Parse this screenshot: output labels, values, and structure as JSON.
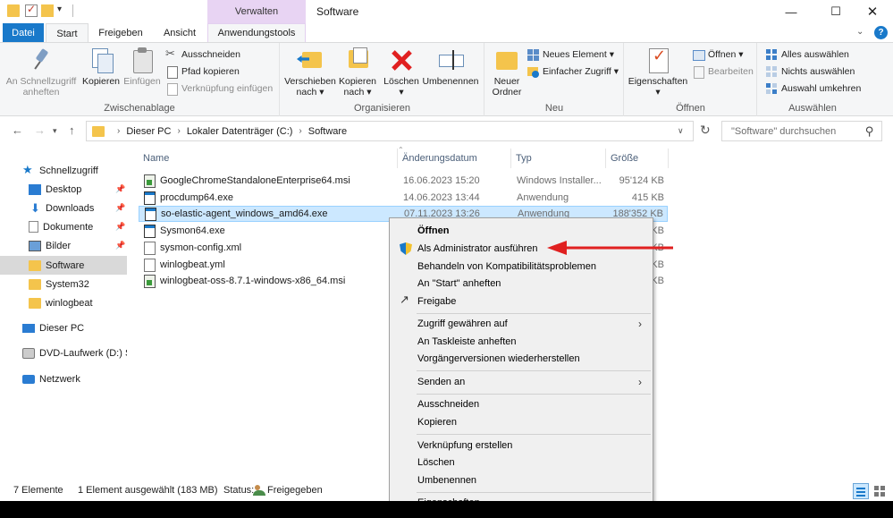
{
  "titlebar": {
    "context_tab_header": "Verwalten",
    "window_title": "Software",
    "minimize": "—",
    "maximize": "☐",
    "close": "✕"
  },
  "tabs": [
    {
      "label": "Datei"
    },
    {
      "label": "Start"
    },
    {
      "label": "Freigeben"
    },
    {
      "label": "Ansicht"
    },
    {
      "label": "Anwendungstools"
    }
  ],
  "ribbon": {
    "clipboard": {
      "label": "Zwischenablage",
      "pin": "An Schnellzugriff anheften",
      "pin_l1": "An Schnellzugriff",
      "pin_l2": "anheften",
      "copy": "Kopieren",
      "paste": "Einfügen",
      "cut": "Ausschneiden",
      "copy_path": "Pfad kopieren",
      "paste_shortcut": "Verknüpfung einfügen"
    },
    "organize": {
      "label": "Organisieren",
      "move_l1": "Verschieben",
      "move_l2": "nach ▾",
      "copyto_l1": "Kopieren",
      "copyto_l2": "nach ▾",
      "delete_l1": "Löschen",
      "delete_l2": "▾",
      "rename": "Umbenennen"
    },
    "new": {
      "label": "Neu",
      "newfolder_l1": "Neuer",
      "newfolder_l2": "Ordner",
      "new_item": "Neues Element ▾",
      "easy_access": "Einfacher Zugriff ▾"
    },
    "open": {
      "label": "Öffnen",
      "properties_l1": "Eigenschaften",
      "properties_l2": "▾",
      "open": "Öffnen ▾",
      "edit": "Bearbeiten"
    },
    "select": {
      "label": "Auswählen",
      "select_all": "Alles auswählen",
      "select_none": "Nichts auswählen",
      "invert": "Auswahl umkehren"
    }
  },
  "address": {
    "crumbs": [
      "Dieser PC",
      "Lokaler Datenträger (C:)",
      "Software"
    ],
    "search_placeholder": "\"Software\" durchsuchen"
  },
  "navpane": [
    {
      "label": "Schnellzugriff",
      "icon": "star-icon"
    },
    {
      "label": "Desktop",
      "icon": "desktop-icon",
      "pinned": true
    },
    {
      "label": "Downloads",
      "icon": "download-icon",
      "pinned": true
    },
    {
      "label": "Dokumente",
      "icon": "documents-icon",
      "pinned": true
    },
    {
      "label": "Bilder",
      "icon": "pictures-icon",
      "pinned": true
    },
    {
      "label": "Software",
      "icon": "folder-icon",
      "selected": true
    },
    {
      "label": "System32",
      "icon": "folder-icon"
    },
    {
      "label": "winlogbeat",
      "icon": "folder-icon"
    },
    {
      "label": "Dieser PC",
      "icon": "pc-icon"
    },
    {
      "label": "DVD-Laufwerk (D:) SS",
      "icon": "dvd-icon"
    },
    {
      "label": "Netzwerk",
      "icon": "network-icon"
    }
  ],
  "columns": {
    "name": "Name",
    "date": "Änderungsdatum",
    "type": "Typ",
    "size": "Größe"
  },
  "files": [
    {
      "name": "GoogleChromeStandaloneEnterprise64.msi",
      "date": "16.06.2023 15:20",
      "type": "Windows Installer...",
      "size": "95'124 KB",
      "icon": "msi-icon"
    },
    {
      "name": "procdump64.exe",
      "date": "14.06.2023 13:44",
      "type": "Anwendung",
      "size": "415 KB",
      "icon": "exe-icon"
    },
    {
      "name": "so-elastic-agent_windows_amd64.exe",
      "date": "07.11.2023 13:26",
      "type": "Anwendung",
      "size": "188'352 KB",
      "icon": "exe-icon",
      "selected": true
    },
    {
      "name": "Sysmon64.exe",
      "date": "",
      "type": "",
      "size": "KB",
      "icon": "exe-icon"
    },
    {
      "name": "sysmon-config.xml",
      "date": "",
      "type": "",
      "size": "KB",
      "icon": "doc-icon"
    },
    {
      "name": "winlogbeat.yml",
      "date": "",
      "type": "",
      "size": "KB",
      "icon": "doc-icon"
    },
    {
      "name": "winlogbeat-oss-8.7.1-windows-x86_64.msi",
      "date": "",
      "type": "",
      "size": "KB",
      "icon": "msi-icon"
    }
  ],
  "context_menu": {
    "open": "Öffnen",
    "run_as_admin": "Als Administrator ausführen",
    "compat": "Behandeln von Kompatibilitätsproblemen",
    "pin_start": "An \"Start\" anheften",
    "share": "Freigabe",
    "grant_access": "Zugriff gewähren auf",
    "pin_taskbar": "An Taskleiste anheften",
    "restore_versions": "Vorgängerversionen wiederherstellen",
    "send_to": "Senden an",
    "cut": "Ausschneiden",
    "copy": "Kopieren",
    "create_shortcut": "Verknüpfung erstellen",
    "delete": "Löschen",
    "rename": "Umbenennen",
    "properties": "Eigenschaften"
  },
  "status": {
    "count": "7 Elemente",
    "selected": "1 Element ausgewählt (183 MB)",
    "share_label": "Status:",
    "share_value": "Freigegeben"
  },
  "colors": {
    "accent": "#1979ca",
    "annotation_arrow": "#e02020",
    "selection": "#cce8ff"
  }
}
